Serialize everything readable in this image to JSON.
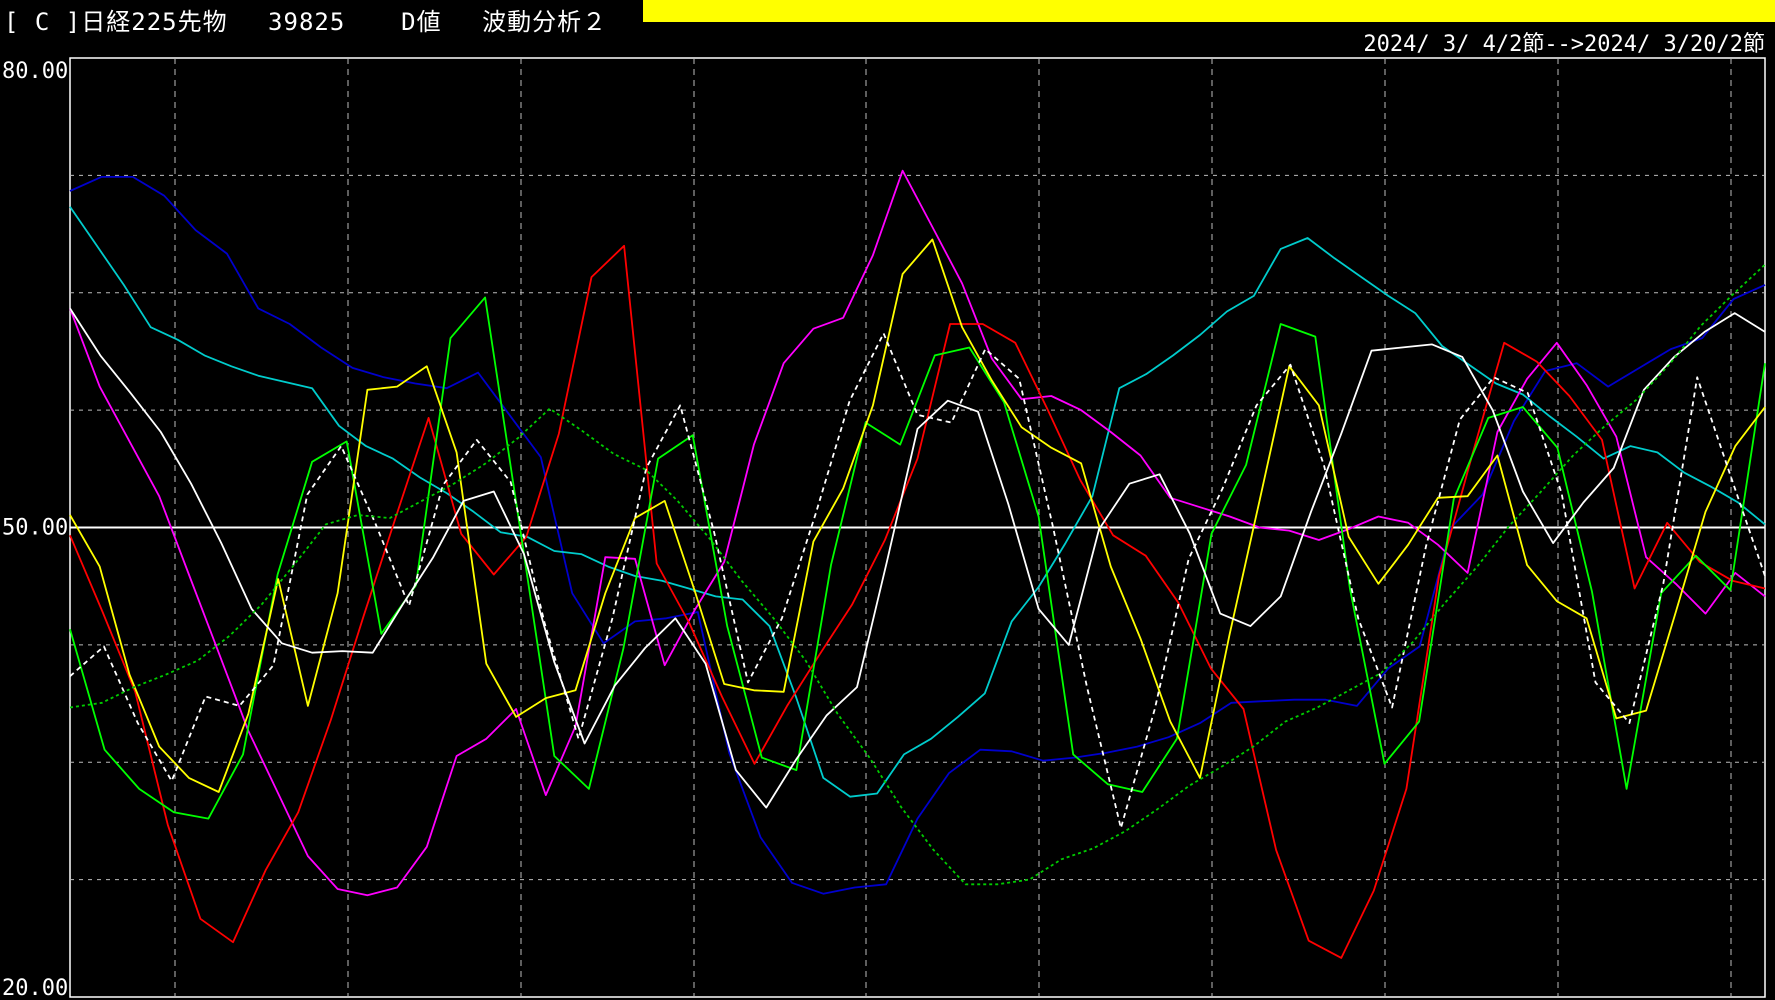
{
  "header": {
    "title": "[ C ]日経225先物　 39825 　 D値 　波動分析２",
    "date_range": "2024/ 3/ 4/2節-->2024/ 3/20/2節",
    "bar_color": "#ffff00"
  },
  "chart_data": {
    "type": "line",
    "title": "",
    "xlabel": "",
    "ylabel": "",
    "ylim": [
      20,
      80
    ],
    "yticks": [
      "80.00",
      "50.00",
      "20.00"
    ],
    "grid": true,
    "reference_line": 50,
    "x": [
      0,
      1,
      2,
      3,
      4,
      5,
      6,
      7,
      8,
      9,
      10,
      11,
      12,
      13,
      14,
      15,
      16,
      17,
      18,
      19,
      20,
      21,
      22,
      23,
      24,
      25
    ],
    "series": [
      {
        "color": "#0000cc",
        "style": "solid",
        "values": [
          71.5,
          72.4,
          72.4,
          71.2,
          69,
          67.5,
          64,
          63,
          61.5,
          60.2,
          59.6,
          59.2,
          58.9,
          59.9,
          57.2,
          54.5,
          45.8,
          42.6,
          44,
          44.2,
          44.6,
          35.6,
          30.2,
          27.3,
          26.6,
          27,
          27.2,
          31.4,
          34.3,
          35.8,
          35.7,
          35.1,
          35.3,
          35.6,
          36,
          36.6,
          37.5,
          38.8,
          38.9,
          39,
          39,
          38.6,
          41,
          42.4,
          50,
          52.1,
          56.8,
          60,
          60.5,
          59,
          60.2,
          61.4,
          62.1,
          64.6,
          65.5
        ]
      },
      {
        "color": "#00cccc",
        "style": "solid",
        "values": [
          70.5,
          68,
          65.5,
          62.8,
          62,
          61,
          60.3,
          59.7,
          59.3,
          58.9,
          56.5,
          55.2,
          54.4,
          53.2,
          52.2,
          51,
          49.7,
          49.4,
          48.5,
          48.3,
          47.5,
          46.9,
          46.6,
          46.1,
          45.6,
          45.4,
          43.7,
          39.1,
          34,
          32.8,
          33,
          35.5,
          36.5,
          37.9,
          39.4,
          44,
          46.2,
          49,
          52,
          58.9,
          59.8,
          61,
          62.3,
          63.8,
          64.8,
          67.8,
          68.5,
          67.2,
          66,
          64.8,
          63.7,
          61.6,
          60.4,
          59.2,
          58.5,
          57.1,
          55.8,
          54.4,
          55.2,
          54.8,
          53.5,
          52.6,
          51.6,
          50.2
        ]
      },
      {
        "color": "#ff00ff",
        "style": "solid",
        "values": [
          64,
          59,
          55.5,
          52,
          47,
          42,
          37,
          33,
          29,
          26.9,
          26.5,
          27,
          29.6,
          35.4,
          36.5,
          38.4,
          32.9,
          37.3,
          48.1,
          48,
          41.2,
          44.7,
          47.8,
          55.3,
          60.5,
          62.7,
          63.4,
          67.4,
          72.8,
          69.2,
          65.6,
          60.8,
          58.2,
          58.4,
          57.5,
          56.1,
          54.6,
          51.9,
          51.3,
          50.7,
          50,
          49.8,
          49.2,
          49.9,
          50.7,
          50.3,
          48.9,
          47.1,
          56.1,
          59.5,
          61.8,
          59.1,
          55.8,
          48.1,
          46.4,
          44.5,
          47.1,
          45.6
        ]
      },
      {
        "color": "#ff0000",
        "style": "solid",
        "values": [
          49.5,
          44.6,
          39.5,
          31,
          25,
          23.5,
          28.1,
          31.8,
          37.7,
          44.3,
          50.7,
          57,
          49.6,
          47,
          49.4,
          56,
          66,
          68,
          47.7,
          43.9,
          39.2,
          34.9,
          38.6,
          41.9,
          45.1,
          49.2,
          54.4,
          63,
          63,
          61.8,
          57.5,
          53,
          49.5,
          48.2,
          45.2,
          41,
          38.4,
          29.4,
          23.6,
          22.5,
          26.8,
          33.3,
          46.9,
          54.5,
          61.8,
          60.6,
          58.4,
          55.6,
          46.1,
          50.3,
          47.8,
          46.6,
          46.1
        ]
      },
      {
        "color": "#00ff00",
        "style": "solid",
        "values": [
          43.5,
          35.8,
          33.3,
          31.8,
          31.4,
          35.5,
          47,
          54.2,
          55.5,
          43.2,
          46.3,
          62.1,
          64.7,
          50.1,
          35.4,
          33.3,
          42.3,
          54.4,
          55.9,
          43.7,
          35.3,
          34.5,
          47.6,
          56.7,
          55.3,
          61,
          61.5,
          58,
          50.7,
          35.5,
          33.6,
          33.1,
          36.5,
          49.6,
          54,
          63,
          62.2,
          46.1,
          34.9,
          37.6,
          51.8,
          57,
          57.7,
          55.1,
          45.9,
          33.3,
          45.8,
          48.2,
          46,
          60.5
        ]
      },
      {
        "color": "#ffff00",
        "style": "solid",
        "values": [
          50.8,
          47.5,
          40.6,
          36,
          34,
          33.1,
          38.1,
          46.7,
          38.6,
          45.8,
          58.8,
          59,
          60.3,
          54.8,
          41.3,
          37.9,
          39.1,
          39.6,
          45.8,
          50.6,
          51.7,
          46,
          40,
          39.6,
          39.5,
          49.1,
          52.5,
          57.8,
          66.2,
          68.4,
          62.8,
          59.4,
          56.4,
          55.1,
          54.1,
          47.5,
          42.9,
          37.6,
          34,
          43.2,
          51.7,
          60.3,
          57.8,
          49.4,
          46.4,
          48.9,
          51.9,
          52,
          54.6,
          47.6,
          45.3,
          44.2,
          37.8,
          38.3,
          44.6,
          51,
          55.2,
          57.7
        ]
      },
      {
        "color": "#ffffff",
        "style": "solid",
        "values": [
          64,
          61,
          58.6,
          56.1,
          52.8,
          49,
          44.8,
          42.6,
          42,
          42.1,
          42,
          45.1,
          48.1,
          51.7,
          52.3,
          48.3,
          41.4,
          36.2,
          39.9,
          42.3,
          44.2,
          41.3,
          34.5,
          32.1,
          35.2,
          38,
          39.8,
          47.9,
          56.3,
          58.1,
          57.4,
          51.5,
          44.8,
          42.5,
          49.9,
          52.8,
          53.4,
          49.6,
          44.5,
          43.7,
          45.6,
          51,
          56,
          61.3,
          61.5,
          61.7,
          60.9,
          57.5,
          52.3,
          49,
          51.6,
          53.8,
          58.8,
          60.9,
          62.5,
          63.7,
          62.5
        ]
      },
      {
        "color": "#ffffff",
        "style": "dashed",
        "values": [
          40.5,
          42.4,
          37.5,
          33.8,
          39.2,
          38.6,
          41.2,
          52.1,
          55.2,
          50.3,
          45,
          52.7,
          55.6,
          52.9,
          43.9,
          36.5,
          44.2,
          53.8,
          57.8,
          49.7,
          40.1,
          44.2,
          50.9,
          58.1,
          62.4,
          57.2,
          56.7,
          61.4,
          59.5,
          50,
          39.8,
          30.8,
          38.4,
          48,
          52.5,
          57.8,
          60.4,
          53.9,
          44.2,
          38.5,
          48.8,
          56.9,
          59.6,
          58.6,
          52.2,
          40.1,
          37.5,
          46.4,
          59.6,
          53.2,
          46.9
        ]
      },
      {
        "color": "#00cc00",
        "style": "dotted",
        "values": [
          38.5,
          38.8,
          39.8,
          40.6,
          41.5,
          43.1,
          45.1,
          47.6,
          50.2,
          50.8,
          50.6,
          51.7,
          52.8,
          54.1,
          55.7,
          57.6,
          56.2,
          54.7,
          53.7,
          51.7,
          49.3,
          46.6,
          44.2,
          41.5,
          38.1,
          35.3,
          32.1,
          29.4,
          27.2,
          27.2,
          27.5,
          28.8,
          29.5,
          30.6,
          32,
          33.5,
          34.7,
          36,
          37.6,
          38.5,
          39.6,
          40.7,
          42.7,
          45.2,
          47.5,
          50.1,
          52.3,
          54.6,
          56.5,
          58.2,
          60.4,
          62.9,
          64.9,
          66.8
        ]
      }
    ]
  }
}
